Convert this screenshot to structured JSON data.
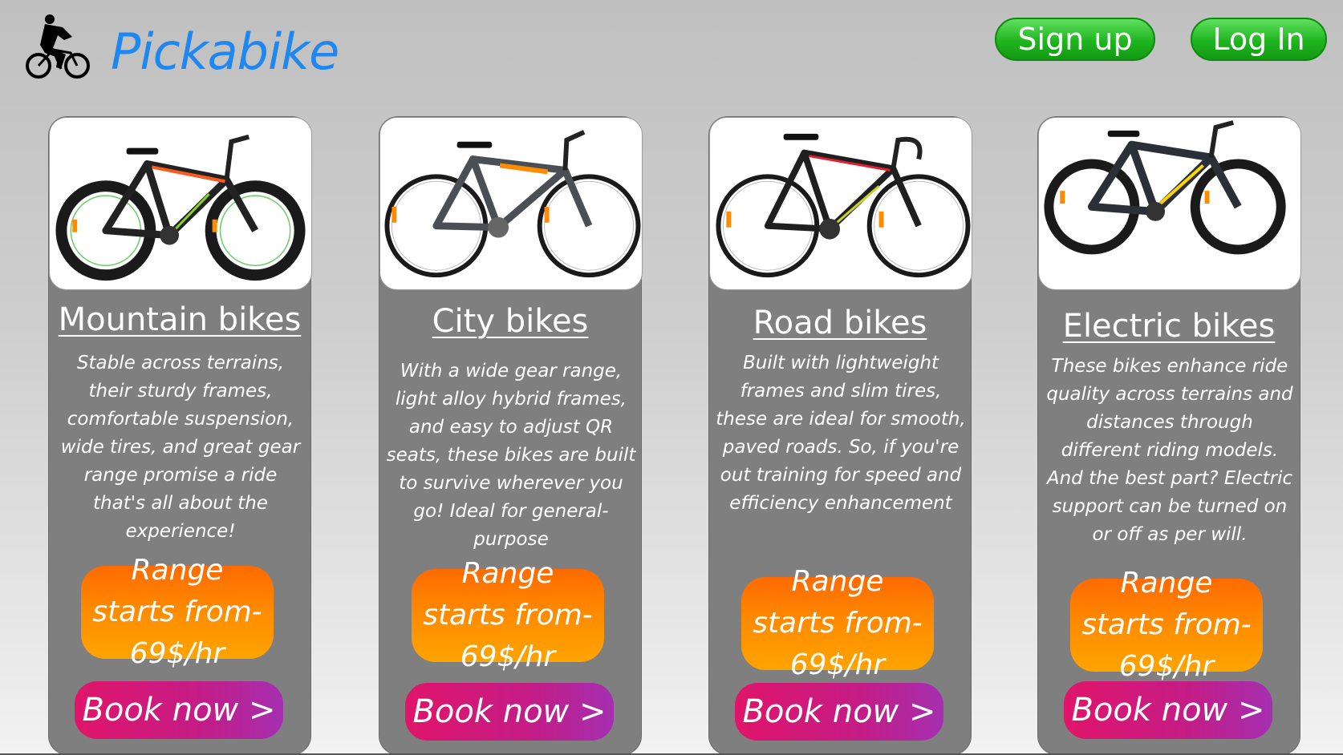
{
  "header": {
    "brand": "Pickabike",
    "logo_icon": "cyclist-icon",
    "signup_label": "Sign up",
    "login_label": "Log In"
  },
  "colors": {
    "brand": "#1e88f0",
    "card_bg": "#7f7f7f",
    "signup_green": "#1fb51f",
    "price_orange": "#ff8c00",
    "book_magenta": "#c41c86"
  },
  "cards": [
    {
      "title": "Mountain bikes",
      "description": "Stable across terrains, their sturdy frames, comfortable suspension, wide tires, and great gear range promise a ride that's all about the experience!",
      "price": "Range starts from- 69$/hr",
      "book_label": "Book now >",
      "image_icon": "mountain-bike-image"
    },
    {
      "title": "City bikes",
      "description": "With a wide gear range, light alloy hybrid frames, and easy to adjust QR seats, these bikes are built to survive wherever you go! Ideal for general-purpose",
      "price": "Range starts from- 69$/hr",
      "book_label": "Book now >",
      "image_icon": "city-bike-image"
    },
    {
      "title": "Road bikes",
      "description": "Built with lightweight frames and slim tires, these are ideal for smooth, paved roads. So, if you're out training for speed and efficiency enhancement",
      "price": "Range starts from- 69$/hr",
      "book_label": "Book now >",
      "image_icon": "road-bike-image"
    },
    {
      "title": "Electric bikes",
      "description": "These bikes enhance ride quality across terrains and distances through different riding models. And the best part? Electric support can be turned on or off as per will.",
      "price": "Range starts from- 69$/hr",
      "book_label": "Book now >",
      "image_icon": "electric-bike-image"
    }
  ]
}
